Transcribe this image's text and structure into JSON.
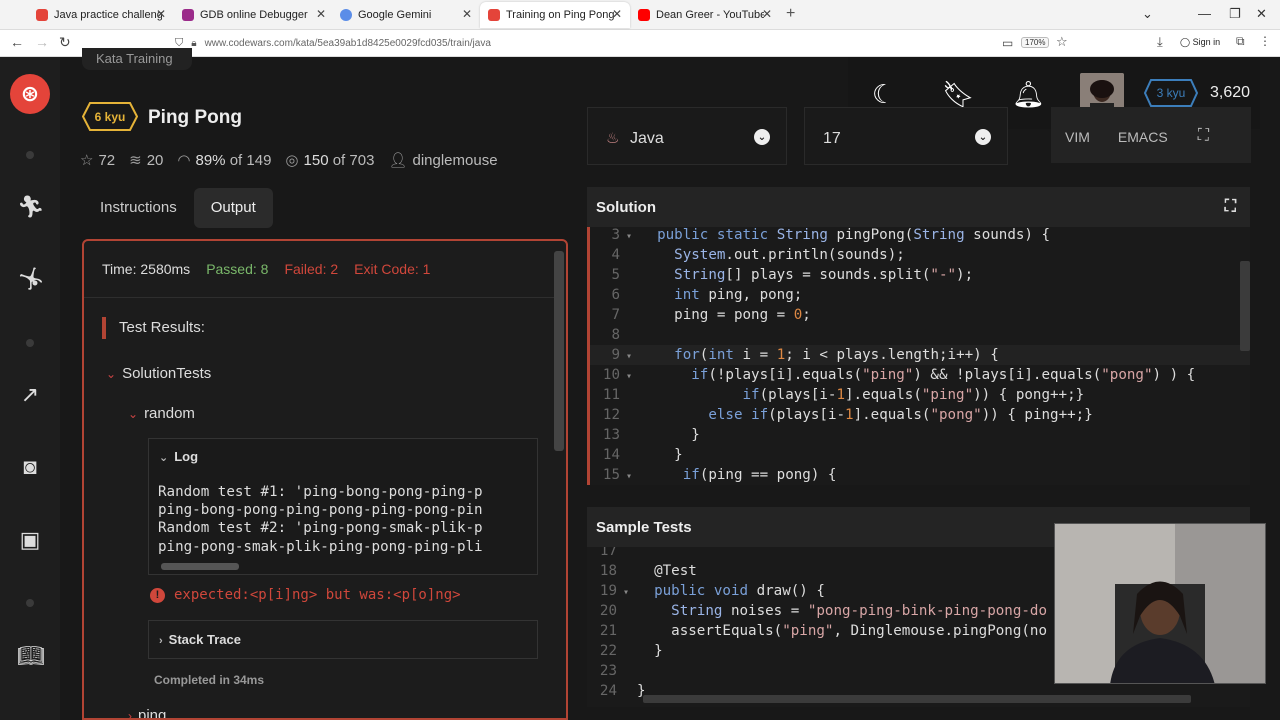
{
  "browser": {
    "tabs": [
      {
        "title": "Java practice challenges - train",
        "favcolor": "#e4443a"
      },
      {
        "title": "GDB online Debugger | Compile",
        "favcolor": "#9b2b8a"
      },
      {
        "title": "Google Gemini",
        "favcolor": "#5b8de8"
      },
      {
        "title": "Training on Ping Pong | Codewa",
        "favcolor": "#e4443a"
      },
      {
        "title": "Dean Greer - YouTube",
        "favcolor": "#ff0000"
      }
    ],
    "url": "www.codewars.com/kata/5ea39ab1d8425e0029fcd035/train/java",
    "zoom": "170%",
    "signin": "Sign in"
  },
  "kata": {
    "breadcrumb": "Kata Training",
    "rank": "6 kyu",
    "title": "Ping Pong",
    "stats": {
      "stars": "72",
      "collections": "20",
      "satisfaction": "89%",
      "satisfaction_of": "of 149",
      "completed": "150",
      "completed_of": "of 703",
      "author": "dinglemouse"
    },
    "tabs": [
      "Instructions",
      "Output"
    ],
    "active_tab": "Output"
  },
  "output": {
    "time": "Time: 2580ms",
    "passed": "Passed: 8",
    "failed": "Failed: 2",
    "exit": "Exit Code: 1",
    "results_title": "Test Results:",
    "group": "SolutionTests",
    "subgroup": "random",
    "log_title": "Log",
    "log_lines": [
      "Random test #1: 'ping-bong-pong-ping-p",
      "ping-bong-pong-ping-pong-ping-pong-pin",
      "Random test #2: 'ping-pong-smak-plik-p",
      "ping-pong-smak-plik-ping-pong-ping-pli"
    ],
    "error": "expected:<p[i]ng> but was:<p[o]ng>",
    "stack_trace": "Stack Trace",
    "completed": "Completed in 34ms",
    "next_group": "ping"
  },
  "user": {
    "kyu": "3 kyu",
    "honor": "3,620"
  },
  "editor": {
    "language": "Java",
    "version": "17",
    "modes": [
      "VIM",
      "EMACS"
    ],
    "solution_title": "Solution",
    "solution_lines": [
      {
        "n": "3",
        "fold": true,
        "code": "  public static String pingPong(String sounds) {"
      },
      {
        "n": "4",
        "fold": false,
        "code": "    System.out.println(sounds);"
      },
      {
        "n": "5",
        "fold": false,
        "code": "    String[] plays = sounds.split(\"-\");"
      },
      {
        "n": "6",
        "fold": false,
        "code": "    int ping, pong;"
      },
      {
        "n": "7",
        "fold": false,
        "code": "    ping = pong = 0;"
      },
      {
        "n": "8",
        "fold": false,
        "code": ""
      },
      {
        "n": "9",
        "fold": true,
        "code": "    for(int i = 1; i < plays.length;i++) {"
      },
      {
        "n": "10",
        "fold": true,
        "code": "      if(!plays[i].equals(\"ping\") && !plays[i].equals(\"pong\") ) {"
      },
      {
        "n": "11",
        "fold": false,
        "code": "            if(plays[i-1].equals(\"ping\")) { pong++;}"
      },
      {
        "n": "12",
        "fold": false,
        "code": "        else if(plays[i-1].equals(\"pong\")) { ping++;}"
      },
      {
        "n": "13",
        "fold": false,
        "code": "      }"
      },
      {
        "n": "14",
        "fold": false,
        "code": "    }"
      },
      {
        "n": "15",
        "fold": true,
        "code": "     if(ping == pong) {"
      }
    ],
    "tests_title": "Sample Tests",
    "test_lines": [
      {
        "n": "17",
        "fold": false,
        "code": ""
      },
      {
        "n": "18",
        "fold": false,
        "code": "  @Test"
      },
      {
        "n": "19",
        "fold": true,
        "code": "  public void draw() {"
      },
      {
        "n": "20",
        "fold": false,
        "code": "    String noises = \"pong-ping-bink-ping-pong-do"
      },
      {
        "n": "21",
        "fold": false,
        "code": "    assertEquals(\"ping\", Dinglemouse.pingPong(no"
      },
      {
        "n": "22",
        "fold": false,
        "code": "  }"
      },
      {
        "n": "23",
        "fold": false,
        "code": ""
      },
      {
        "n": "24",
        "fold": false,
        "code": "}"
      }
    ]
  }
}
